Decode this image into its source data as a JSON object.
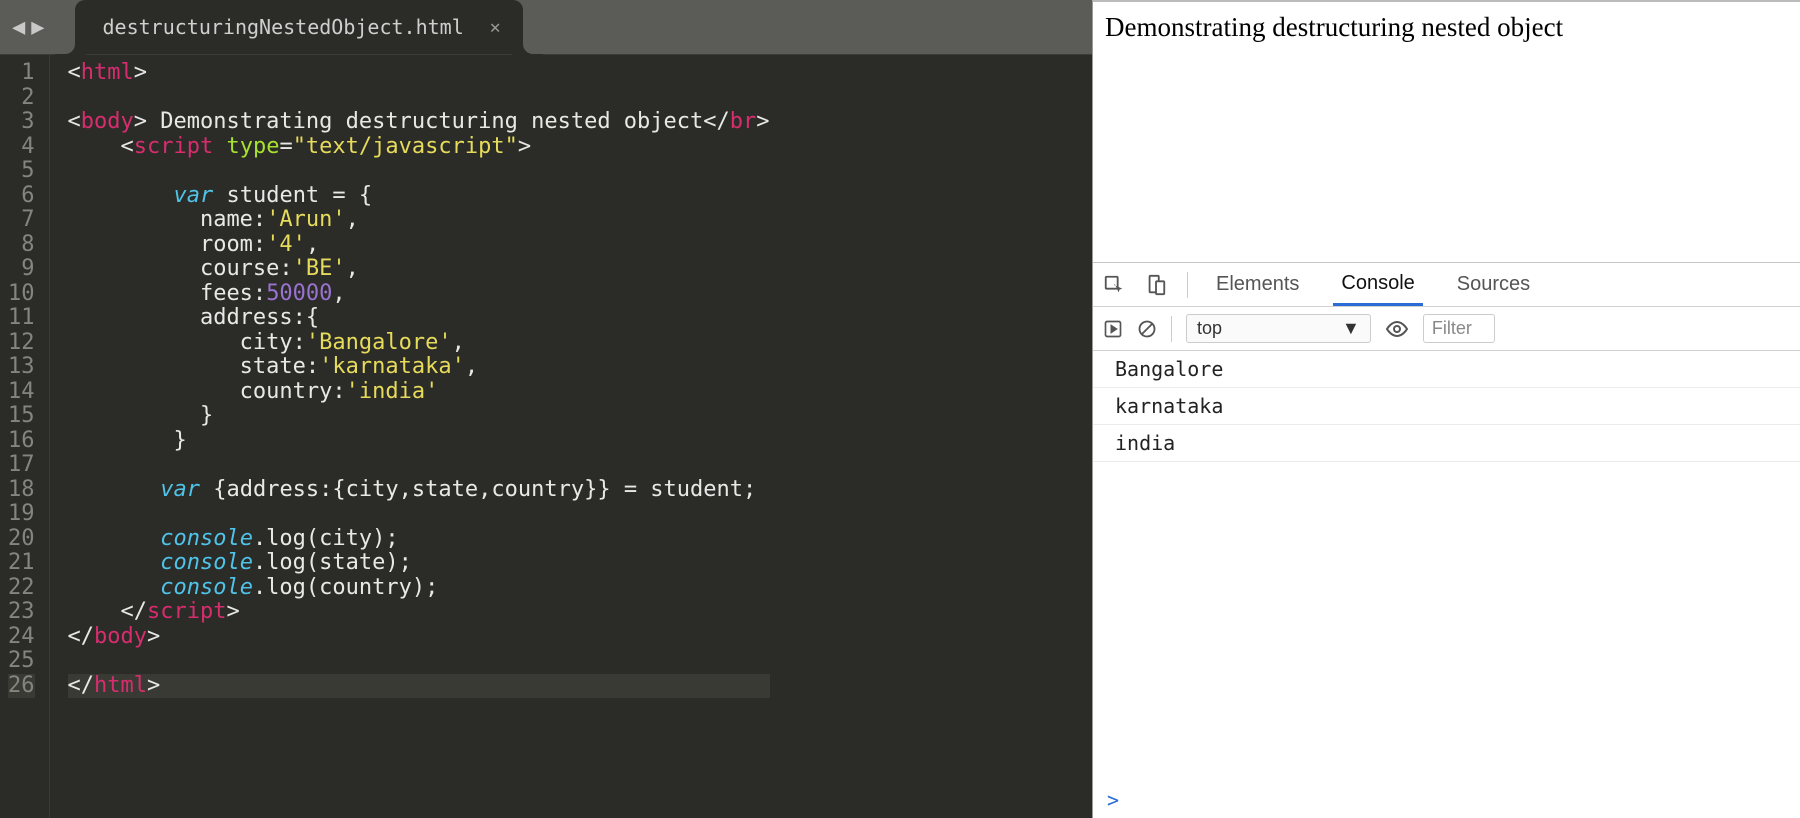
{
  "editor": {
    "tab_title": "destructuringNestedObject.html",
    "line_numbers": [
      "1",
      "2",
      "3",
      "4",
      "5",
      "6",
      "7",
      "8",
      "9",
      "10",
      "11",
      "12",
      "13",
      "14",
      "15",
      "16",
      "17",
      "18",
      "19",
      "20",
      "21",
      "22",
      "23",
      "24",
      "25",
      "26"
    ],
    "current_line": 26,
    "code_tokens": [
      [
        [
          "<",
          "pun"
        ],
        [
          "html",
          "tag"
        ],
        [
          ">",
          "pun"
        ]
      ],
      [],
      [
        [
          "<",
          "pun"
        ],
        [
          "body",
          "tag"
        ],
        [
          "> Demonstrating destructuring nested object</",
          "pun"
        ],
        [
          "br",
          "tag"
        ],
        [
          ">",
          "pun"
        ]
      ],
      [
        [
          "    <",
          "pun"
        ],
        [
          "script ",
          "tag"
        ],
        [
          "type",
          "attr"
        ],
        [
          "=",
          "pun"
        ],
        [
          "\"text/javascript\"",
          "str"
        ],
        [
          ">",
          "pun"
        ]
      ],
      [],
      [
        [
          "        ",
          "pun"
        ],
        [
          "var",
          "kw"
        ],
        [
          " student = {",
          "pun"
        ]
      ],
      [
        [
          "          name:",
          "pun"
        ],
        [
          "'Arun'",
          "str"
        ],
        [
          ",",
          "pun"
        ]
      ],
      [
        [
          "          room:",
          "pun"
        ],
        [
          "'4'",
          "str"
        ],
        [
          ",",
          "pun"
        ]
      ],
      [
        [
          "          course:",
          "pun"
        ],
        [
          "'BE'",
          "str"
        ],
        [
          ",",
          "pun"
        ]
      ],
      [
        [
          "          fees:",
          "pun"
        ],
        [
          "50000",
          "num"
        ],
        [
          ",",
          "pun"
        ]
      ],
      [
        [
          "          address:{",
          "pun"
        ]
      ],
      [
        [
          "             city:",
          "pun"
        ],
        [
          "'Bangalore'",
          "str"
        ],
        [
          ",",
          "pun"
        ]
      ],
      [
        [
          "             state:",
          "pun"
        ],
        [
          "'karnataka'",
          "str"
        ],
        [
          ",",
          "pun"
        ]
      ],
      [
        [
          "             country:",
          "pun"
        ],
        [
          "'india'",
          "str"
        ]
      ],
      [
        [
          "          }",
          "pun"
        ]
      ],
      [
        [
          "        }",
          "pun"
        ]
      ],
      [],
      [
        [
          "       ",
          "pun"
        ],
        [
          "var",
          "kw"
        ],
        [
          " {address:{city,state,country}} = student;",
          "pun"
        ]
      ],
      [],
      [
        [
          "       ",
          "pun"
        ],
        [
          "console",
          "obj"
        ],
        [
          ".log(city);",
          "pun"
        ]
      ],
      [
        [
          "       ",
          "pun"
        ],
        [
          "console",
          "obj"
        ],
        [
          ".log(state);",
          "pun"
        ]
      ],
      [
        [
          "       ",
          "pun"
        ],
        [
          "console",
          "obj"
        ],
        [
          ".log(country);",
          "pun"
        ]
      ],
      [
        [
          "    </",
          "pun"
        ],
        [
          "script",
          "tag"
        ],
        [
          ">",
          "pun"
        ]
      ],
      [
        [
          "</",
          "pun"
        ],
        [
          "body",
          "tag"
        ],
        [
          ">",
          "pun"
        ]
      ],
      [],
      [
        [
          "</",
          "pun"
        ],
        [
          "html",
          "tag"
        ],
        [
          ">",
          "pun"
        ]
      ]
    ]
  },
  "browser": {
    "page_text": "Demonstrating destructuring nested object"
  },
  "devtools": {
    "tabs": [
      "Elements",
      "Console",
      "Sources"
    ],
    "active_tab": "Console",
    "context_label": "top",
    "filter_placeholder": "Filter",
    "console_output": [
      "Bangalore",
      "karnataka",
      "india"
    ],
    "prompt": ">"
  }
}
